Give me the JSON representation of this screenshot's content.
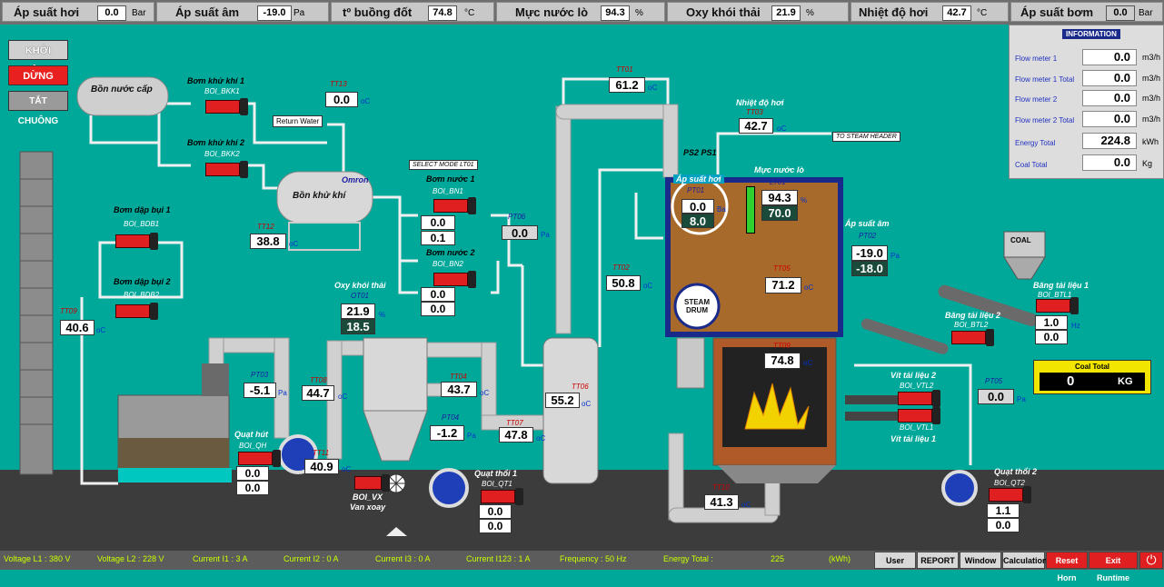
{
  "topbar": {
    "steam_pressure": {
      "label": "Áp suất hơi",
      "value": "0.0",
      "unit": "Bar"
    },
    "negative_pressure": {
      "label": "Áp suất âm",
      "value": "-19.0",
      "unit": "Pa"
    },
    "chamber_temp": {
      "label": "tº buồng đốt",
      "value": "74.8",
      "unit": "°C"
    },
    "water_level": {
      "label": "Mực nước lò",
      "value": "94.3",
      "unit": "%"
    },
    "oxy": {
      "label": "Oxy khói thải",
      "value": "21.9",
      "unit": "%"
    },
    "steam_temp": {
      "label": "Nhiệt độ hơi",
      "value": "42.7",
      "unit": "°C"
    },
    "pump_pressure": {
      "label": "Áp suất bơm",
      "value": "0.0",
      "unit": "Bar"
    }
  },
  "controls": {
    "start": "KHỞI ĐỘNG",
    "stop": "DỪNG",
    "mute": "TẮT CHUÔNG"
  },
  "info": {
    "title": "INFORMATION",
    "rows": [
      {
        "label": "Flow meter 1",
        "value": "0.0",
        "unit": "m3/h"
      },
      {
        "label": "Flow meter 1 Total",
        "value": "0.0",
        "unit": "m3/h"
      },
      {
        "label": "Flow meter 2",
        "value": "0.0",
        "unit": "m3/h"
      },
      {
        "label": "Flow meter 2 Total",
        "value": "0.0",
        "unit": "m3/h"
      },
      {
        "label": "Energy Total",
        "value": "224.8",
        "unit": "kWh"
      },
      {
        "label": "Coal Total",
        "value": "0.0",
        "unit": "Kg"
      }
    ]
  },
  "equipment": {
    "feed_tank": "Bồn nước cấp",
    "deaerator": "Bồn khử khí",
    "omron": "Omron",
    "return_water": "Return Water",
    "select_mode": "SELECT MODE LT01",
    "to_steam_header": "TO STEAM HEADER",
    "steam_drum": "STEAM DRUM",
    "coal": "COAL"
  },
  "pumps": {
    "bkk1": {
      "name": "Bơm khử khí 1",
      "tag": "BOI_BKK1"
    },
    "bkk2": {
      "name": "Bơm khử khí 2",
      "tag": "BOI_BKK2"
    },
    "bdb1": {
      "name": "Bơm dập bụi 1",
      "tag": "BOI_BDB1"
    },
    "bdb2": {
      "name": "Bơm dập bụi 2",
      "tag": "BOI_BDB2"
    },
    "bn1": {
      "name": "Bơm nước 1",
      "tag": "BOI_BN1",
      "v1": "0.0",
      "v2": "0.1"
    },
    "bn2": {
      "name": "Bơm nước 2",
      "tag": "BOI_BN2",
      "v1": "0.0",
      "v2": "0.0"
    }
  },
  "sensors": {
    "tt13": {
      "tag": "TT13",
      "value": "0.0",
      "unit": "oC"
    },
    "tt12": {
      "tag": "TT12",
      "value": "38.8",
      "unit": "oC"
    },
    "tt01": {
      "tag": "TT01",
      "value": "61.2",
      "unit": "oC"
    },
    "tt09": {
      "tag": "TT09",
      "value": "40.6",
      "unit": "oC"
    },
    "pt06": {
      "tag": "PT06",
      "value": "0.0",
      "unit": "Pa"
    },
    "tt02": {
      "tag": "TT02",
      "value": "50.8",
      "unit": "oC"
    },
    "tt03": {
      "tag": "TT03",
      "value": "42.7",
      "unit": "oC"
    },
    "steam_temp_label": "Nhiệt độ hơi",
    "pt03": {
      "tag": "PT03",
      "value": "-5.1",
      "unit": "Pa"
    },
    "tt08": {
      "tag": "TT08",
      "value": "44.7",
      "unit": "oC"
    },
    "tt04": {
      "tag": "TT04",
      "value": "43.7",
      "unit": "oC"
    },
    "pt04": {
      "tag": "PT04",
      "value": "-1.2",
      "unit": "Pa"
    },
    "tt07": {
      "tag": "TT07",
      "value": "47.8",
      "unit": "oC"
    },
    "tt06": {
      "tag": "TT06",
      "value": "55.2",
      "unit": "oC"
    },
    "tt11": {
      "tag": "TT11",
      "value": "40.9",
      "unit": "oC"
    },
    "tt10": {
      "tag": "TT10",
      "value": "41.3",
      "unit": "oC"
    },
    "tt05": {
      "tag": "TT05",
      "value": "71.2",
      "unit": "oC"
    },
    "tt09b": {
      "tag": "TT09",
      "value": "74.8",
      "unit": "oC"
    },
    "pt05": {
      "tag": "PT05",
      "value": "0.0",
      "unit": "Pa"
    }
  },
  "oxy_sensor": {
    "name": "Oxy khói thải",
    "tag": "OT01",
    "value1": "21.9",
    "value2": "18.5",
    "unit": "%"
  },
  "drum": {
    "pt01": {
      "title": "Áp suất hơi",
      "tag": "PT01",
      "v1": "0.0",
      "v2": "8.0",
      "unit": "Ba"
    },
    "ps": "PS2 PS1",
    "lt01": {
      "title": "Mực nước lò",
      "tag": "LT01",
      "v1": "94.3",
      "v2": "70.0",
      "unit": "%"
    },
    "pt02": {
      "title": "Áp suất âm",
      "tag": "PT02",
      "v1": "-19.0",
      "v2": "-18.0",
      "unit": "Pa"
    }
  },
  "fans": {
    "qh": {
      "name": "Quạt hút",
      "tag": "BOI_QH",
      "v1": "0.0",
      "v2": "0.0"
    },
    "qt1": {
      "name": "Quạt thổi 1",
      "tag": "BOI_QT1",
      "v1": "0.0",
      "v2": "0.0"
    },
    "qt2": {
      "name": "Quạt thổi 2",
      "tag": "BOI_QT2",
      "v1": "1.1",
      "v2": "0.0"
    }
  },
  "valve": {
    "tag": "BOI_VX",
    "name": "Van xoay"
  },
  "conveyors": {
    "btl1": {
      "name": "Băng tải liệu 1",
      "tag": "BOI_BTL1",
      "v1": "1.0",
      "v2": "0.0",
      "unit": "Hz"
    },
    "btl2": {
      "name": "Băng tải liệu 2",
      "tag": "BOI_BTL2"
    },
    "vtl2": {
      "name": "Vít tải liệu 2",
      "tag": "BOI_VTL2"
    },
    "vtl1": {
      "name": "Vít tải liệu 1",
      "tag": "BOI_VTL1"
    }
  },
  "coal_total": {
    "title": "Coal Total",
    "value": "0",
    "unit": "KG"
  },
  "bottombar": {
    "items": [
      "Voltage L1 :  380  V",
      "Voltage L2 :  228  V",
      "Current I1 :   3    A",
      "Current I2 :   0    A",
      "Current I3 :   0    A",
      "Current I123 :  1    A",
      "Frequency :  50  Hz",
      "Energy Total :",
      "225",
      "(kWh)"
    ],
    "buttons": [
      "User",
      "REPORT",
      "Window",
      "Calculation",
      "Reset Horn",
      "Exit Runtime"
    ]
  },
  "colors": {
    "background": "#00a89a",
    "alarm": "#e02020",
    "accent_blue": "#0033cc"
  }
}
